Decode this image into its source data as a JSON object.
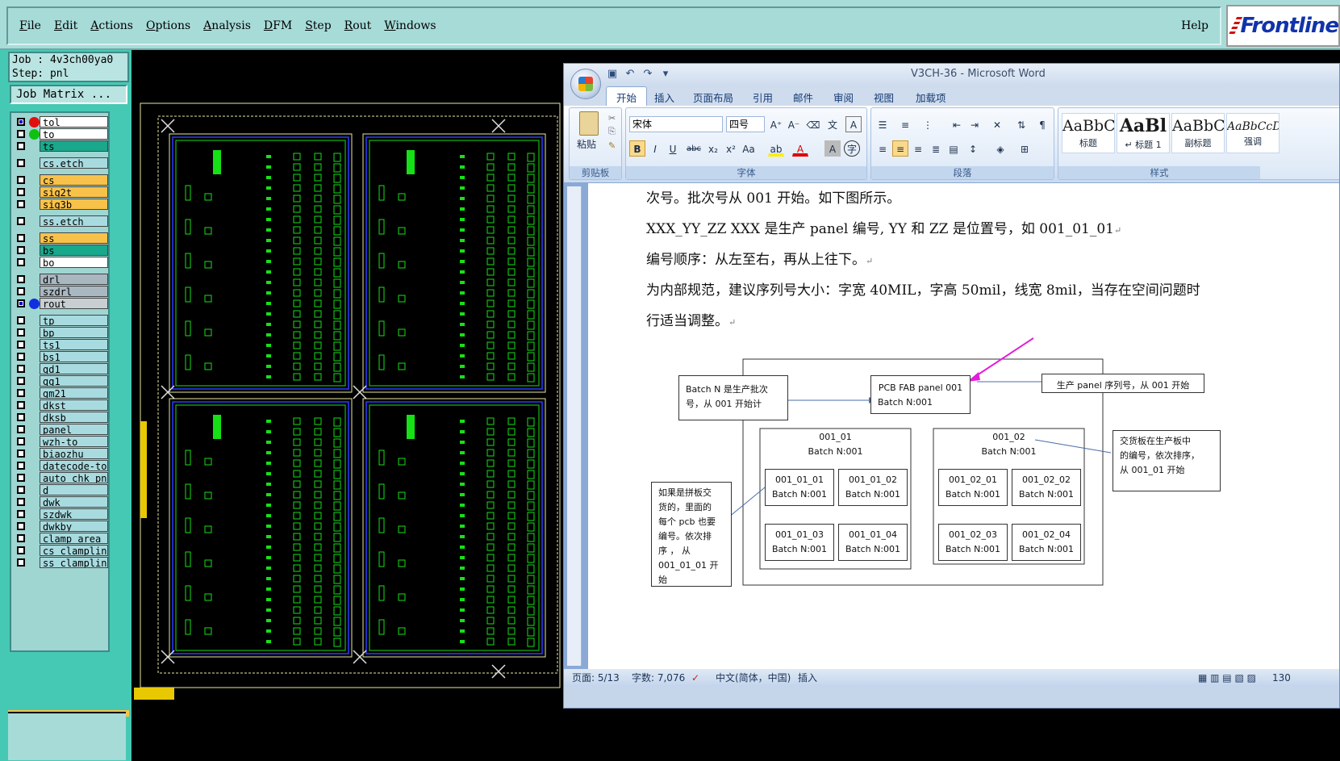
{
  "frontline": {
    "menu": [
      "File",
      "Edit",
      "Actions",
      "Options",
      "Analysis",
      "DFM",
      "Step",
      "Rout",
      "Windows"
    ],
    "help": "Help",
    "logo": "Frontline"
  },
  "job": {
    "job_line": "Job : 4v3ch00ya0",
    "step_line": "Step: pnl",
    "matrix_button": "Job Matrix ..."
  },
  "layers": [
    {
      "name": "tol",
      "color": "white",
      "dot": "#e01010",
      "checked": true
    },
    {
      "name": "to",
      "color": "white",
      "dot": "#10c010",
      "checked": false
    },
    {
      "name": "ts",
      "color": "teal",
      "dot": "",
      "checked": false
    },
    {
      "name": "cs.etch",
      "color": "lb",
      "dot": "",
      "checked": false
    },
    {
      "name": "cs",
      "color": "or",
      "dot": "",
      "checked": false
    },
    {
      "name": "sig2t",
      "color": "or",
      "dot": "",
      "checked": false
    },
    {
      "name": "sig3b",
      "color": "or",
      "dot": "",
      "checked": false
    },
    {
      "name": "ss.etch",
      "color": "lb",
      "dot": "",
      "checked": false
    },
    {
      "name": "ss",
      "color": "or",
      "dot": "",
      "checked": false
    },
    {
      "name": "bs",
      "color": "teal",
      "dot": "",
      "checked": false
    },
    {
      "name": "bo",
      "color": "white",
      "dot": "",
      "checked": false
    },
    {
      "name": "drl",
      "color": "gr",
      "dot": "",
      "checked": false
    },
    {
      "name": "szdrl",
      "color": "gr",
      "dot": "",
      "checked": false
    },
    {
      "name": "rout",
      "color": "lgr",
      "dot": "#1030e0",
      "checked": true
    },
    {
      "name": "tp",
      "color": "lb",
      "dot": "",
      "checked": false
    },
    {
      "name": "bp",
      "color": "lb",
      "dot": "",
      "checked": false
    },
    {
      "name": "ts1",
      "color": "lb",
      "dot": "",
      "checked": false
    },
    {
      "name": "bs1",
      "color": "lb",
      "dot": "",
      "checked": false
    },
    {
      "name": "gd1",
      "color": "lb",
      "dot": "",
      "checked": false
    },
    {
      "name": "gg1",
      "color": "lb",
      "dot": "",
      "checked": false
    },
    {
      "name": "gm21",
      "color": "lb",
      "dot": "",
      "checked": false
    },
    {
      "name": "dkst",
      "color": "lb",
      "dot": "",
      "checked": false
    },
    {
      "name": "dksb",
      "color": "lb",
      "dot": "",
      "checked": false
    },
    {
      "name": "panel",
      "color": "lb",
      "dot": "",
      "checked": false
    },
    {
      "name": "wzh-to",
      "color": "lb",
      "dot": "",
      "checked": false
    },
    {
      "name": "biaozhu",
      "color": "lb",
      "dot": "",
      "checked": false
    },
    {
      "name": "datecode-to",
      "color": "lb",
      "dot": "",
      "checked": false
    },
    {
      "name": "auto_chk_pnl",
      "color": "lb",
      "dot": "",
      "checked": false
    },
    {
      "name": "d",
      "color": "lb",
      "dot": "",
      "checked": false
    },
    {
      "name": "dwk",
      "color": "lb",
      "dot": "",
      "checked": false
    },
    {
      "name": "szdwk",
      "color": "lb",
      "dot": "",
      "checked": false
    },
    {
      "name": "dwkby",
      "color": "lb",
      "dot": "",
      "checked": false
    },
    {
      "name": "clamp_area",
      "color": "lb",
      "dot": "",
      "checked": false
    },
    {
      "name": "cs_clampline",
      "color": "lb",
      "dot": "",
      "checked": false
    },
    {
      "name": "ss_clampline",
      "color": "lb",
      "dot": "",
      "checked": false
    }
  ],
  "word": {
    "title": "V3CH-36 - Microsoft Word",
    "tabs": [
      "开始",
      "插入",
      "页面布局",
      "引用",
      "邮件",
      "审阅",
      "视图",
      "加载项"
    ],
    "font_name": "宋体",
    "font_size": "四号",
    "paste_label": "粘贴",
    "groups": {
      "clipboard": "剪贴板",
      "font": "字体",
      "paragraph": "段落",
      "styles": "样式"
    },
    "styles": [
      {
        "sample": "AaBbC(",
        "name": "标题"
      },
      {
        "sample": "AaBl",
        "name": "↵ 标题 1"
      },
      {
        "sample": "AaBbC(",
        "name": "副标题"
      },
      {
        "sample": "AaBbCcDd",
        "name": "强调"
      }
    ],
    "paragraphs": [
      "次号。批次号从 001 开始。如下图所示。",
      "XXX_YY_ZZ   XXX  是生产 panel 编号, YY  和  ZZ   是位置号，如 001_01_01",
      "编号顺序：从左至右，再从上往下。",
      "为内部规范，建议序列号大小：字宽 40MIL，字高 50mil，线宽 8mil，当存在空间问题时",
      "行适当调整。"
    ],
    "diagram": {
      "batch_note": [
        "Batch  N  是生产批次",
        "号，从 001 开始计"
      ],
      "fab_box": [
        "PCB  FAB  panel  001",
        "Batch N:001"
      ],
      "serial_note": "生产  panel  序列号，从 001 开始",
      "g1": {
        "title": "001_01",
        "batch": "Batch N:001"
      },
      "g2": {
        "title": "001_02",
        "batch": "Batch N:001"
      },
      "cells": [
        {
          "id": "001_01_01",
          "batch": "Batch N:001"
        },
        {
          "id": "001_01_02",
          "batch": "Batch N:001"
        },
        {
          "id": "001_01_03",
          "batch": "Batch N:001"
        },
        {
          "id": "001_01_04",
          "batch": "Batch N:001"
        },
        {
          "id": "001_02_01",
          "batch": "Batch N:001"
        },
        {
          "id": "001_02_02",
          "batch": "Batch N:001"
        },
        {
          "id": "001_02_03",
          "batch": "Batch N:001"
        },
        {
          "id": "001_02_04",
          "batch": "Batch N:001"
        }
      ],
      "left_note": [
        "如果是拼板交",
        "货的，里面的",
        "每个  pcb  也要",
        "编号。依次排",
        "序     ，     从",
        "001_01_01   开",
        "始"
      ],
      "right_note": [
        "交货板在生产板中",
        "的编号，依次排序，",
        "从 001_01 开始"
      ]
    },
    "status": {
      "page": "页面: 5/13",
      "words": "字数: 7,076",
      "lang": "中文(简体，中国)",
      "mode": "插入",
      "zoom": "130"
    }
  }
}
